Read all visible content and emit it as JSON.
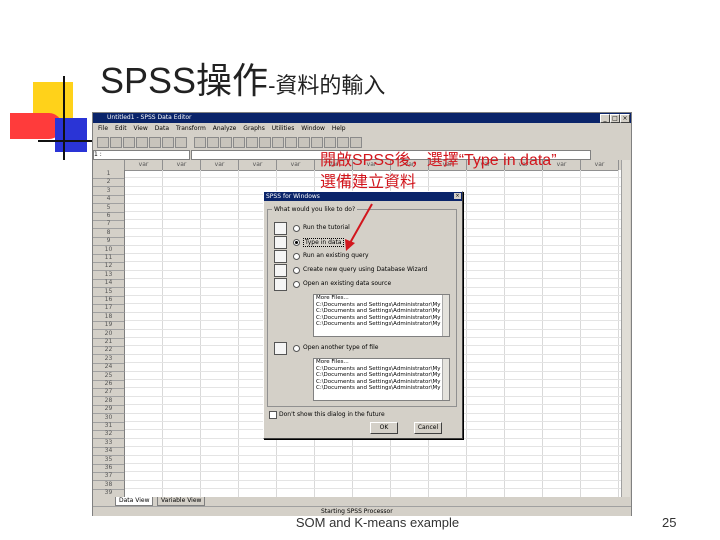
{
  "slide": {
    "title_main": "SPSS操作",
    "title_sub": "-資料的輸入",
    "footer": "SOM and K-means example",
    "page_number": "25",
    "annotation_line1": "開啟SPSS後，選擇“Type in data”",
    "annotation_line2": "選備建立資料"
  },
  "spss": {
    "window_title": "Untitled1 - SPSS Data Editor",
    "menu": [
      "File",
      "Edit",
      "View",
      "Data",
      "Transform",
      "Analyze",
      "Graphs",
      "Utilities",
      "Window",
      "Help"
    ],
    "cell_ref": "1 :",
    "column_header": "var",
    "rows": [
      "1",
      "2",
      "3",
      "4",
      "5",
      "6",
      "7",
      "8",
      "9",
      "10",
      "11",
      "12",
      "13",
      "14",
      "15",
      "16",
      "17",
      "18",
      "19",
      "20",
      "21",
      "22",
      "23",
      "24",
      "25",
      "26",
      "27",
      "28",
      "29",
      "30",
      "31",
      "32",
      "33",
      "34",
      "35",
      "36",
      "37",
      "38",
      "39",
      "40"
    ],
    "tabs": {
      "data_view": "Data View",
      "variable_view": "Variable View"
    },
    "status": "Starting SPSS Processor"
  },
  "dialog": {
    "title": "SPSS for Windows",
    "question": "What would you like to do?",
    "options": [
      {
        "label": "Run the tutorial",
        "selected": false
      },
      {
        "label": "Type in data",
        "selected": true
      },
      {
        "label": "Run an existing query",
        "selected": false
      },
      {
        "label": "Create new query using Database Wizard",
        "selected": false
      },
      {
        "label": "Open an existing data source",
        "selected": false
      },
      {
        "label": "Open another type of file",
        "selected": false
      }
    ],
    "list1": [
      "More Files...",
      "C:\\Documents and Settings\\Administrator\\My Docu...",
      "C:\\Documents and Settings\\Administrator\\My Docu...",
      "C:\\Documents and Settings\\Administrator\\My Docu...",
      "C:\\Documents and Settings\\Administrator\\My Docu..."
    ],
    "list2": [
      "More Files...",
      "C:\\Documents and Settings\\Administrator\\My Docu...",
      "C:\\Documents and Settings\\Administrator\\My Docu...",
      "C:\\Documents and Settings\\Administrator\\My Docu...",
      "C:\\Documents and Settings\\Administrator\\My Docu..."
    ],
    "checkbox_label": "Don't show this dialog in the future",
    "ok_label": "OK",
    "cancel_label": "Cancel"
  },
  "colors": {
    "annotation": "#d2161d",
    "titlebar": "#0a246a"
  }
}
